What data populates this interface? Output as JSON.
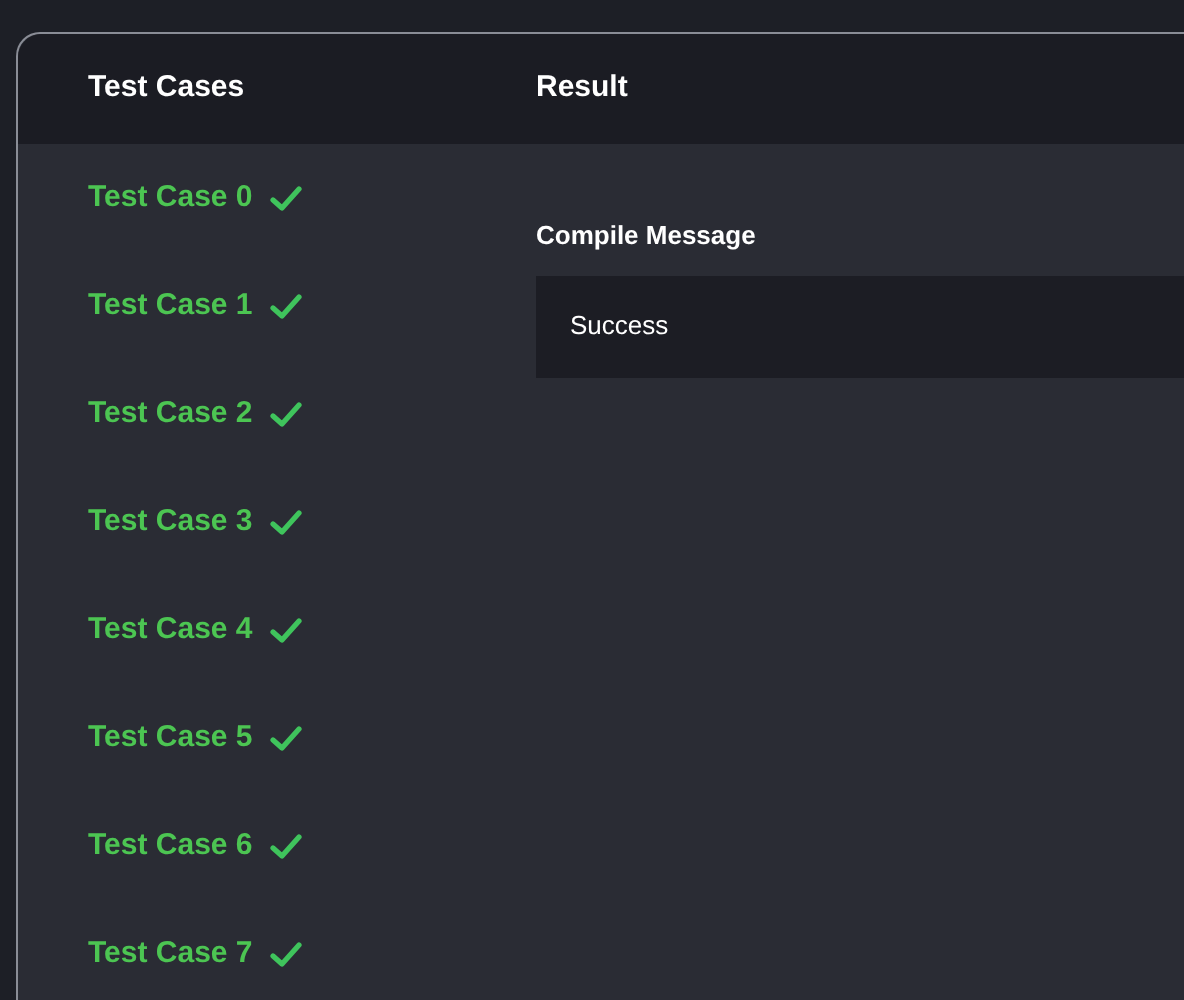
{
  "header": {
    "column_1": "Test Cases",
    "column_2": "Result"
  },
  "test_cases": [
    {
      "label": "Test Case 0",
      "passed": true
    },
    {
      "label": "Test Case 1",
      "passed": true
    },
    {
      "label": "Test Case 2",
      "passed": true
    },
    {
      "label": "Test Case 3",
      "passed": true
    },
    {
      "label": "Test Case 4",
      "passed": true
    },
    {
      "label": "Test Case 5",
      "passed": true
    },
    {
      "label": "Test Case 6",
      "passed": true
    },
    {
      "label": "Test Case 7",
      "passed": true
    }
  ],
  "result": {
    "heading": "Compile Message",
    "message": "Success"
  }
}
